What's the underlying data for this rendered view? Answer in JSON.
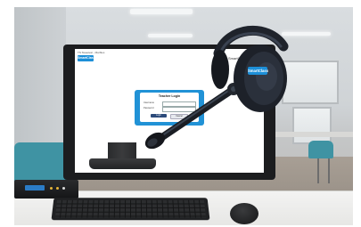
{
  "screen": {
    "window_title": "TS Sweetest - Marbles",
    "brand_logo": "SmartClass",
    "brand_text": "SmartClass",
    "login": {
      "heading": "Teacher Login",
      "username_label": "Username",
      "password_label": "Password",
      "login_button": "Login",
      "cancel_button": "Cancel"
    }
  },
  "headset": {
    "logo": "SmartClass"
  },
  "colors": {
    "brand_blue": "#2192d6",
    "screen_bg": "#ffffff",
    "chair_teal": "#3f93a3",
    "device_blue": "#2b7cc6"
  }
}
